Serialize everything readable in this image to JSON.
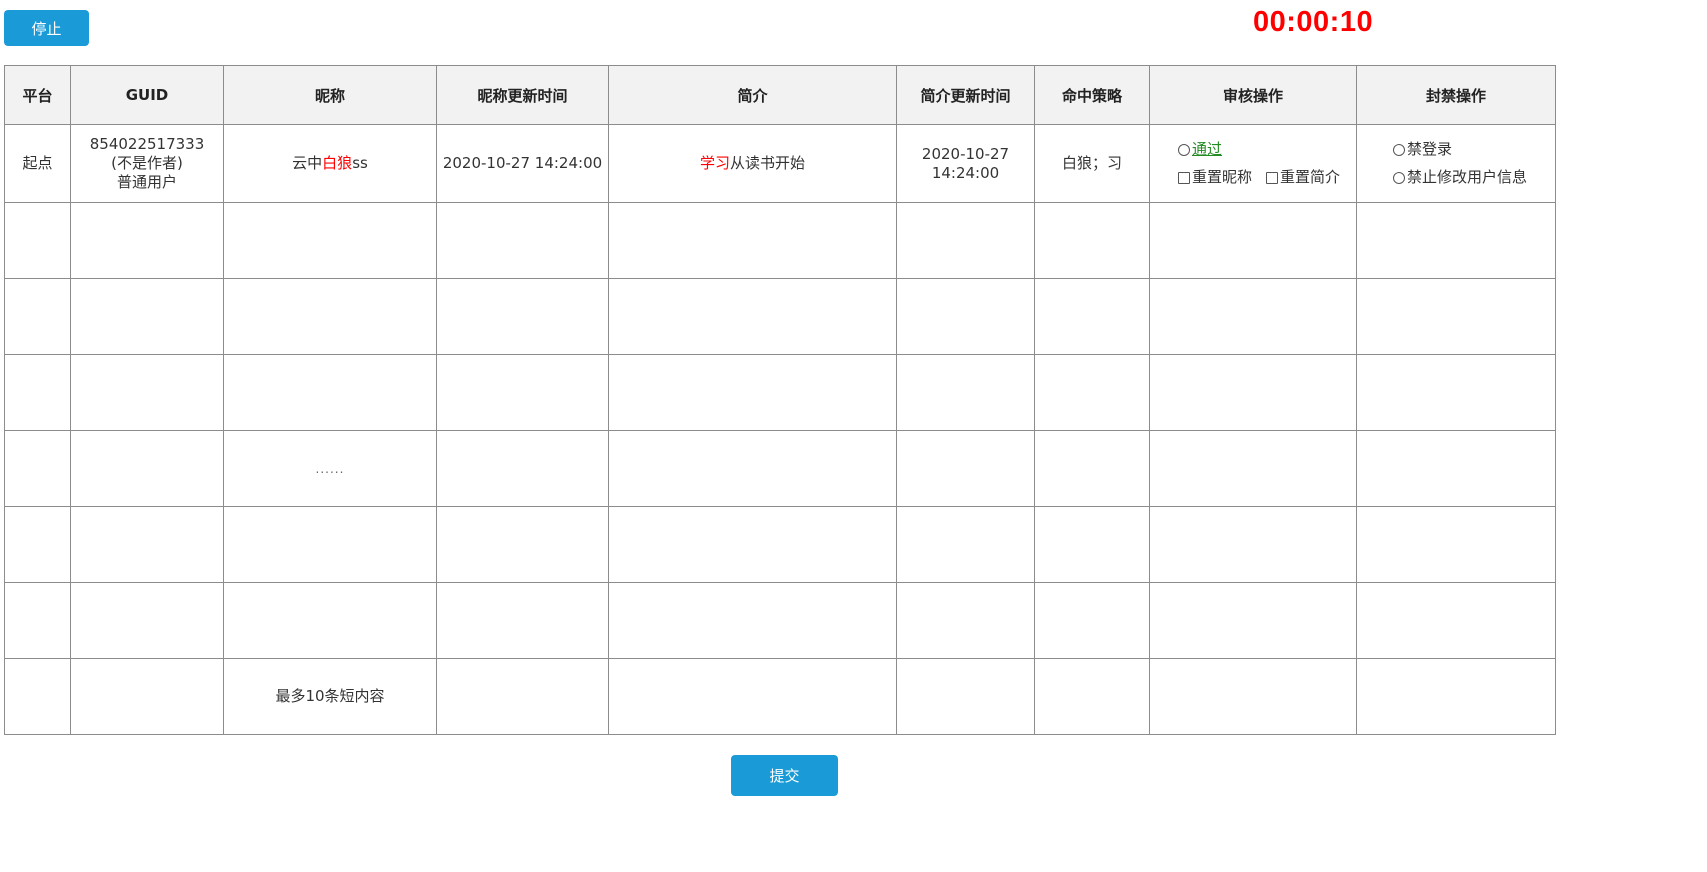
{
  "controls": {
    "stop_label": "停止",
    "submit_label": "提交",
    "timer": "00:00:10"
  },
  "table": {
    "headers": [
      "平台",
      "GUID",
      "昵称",
      "昵称更新时间",
      "简介",
      "简介更新时间",
      "命中策略",
      "审核操作",
      "封禁操作"
    ],
    "row": {
      "platform": "起点",
      "guid_id": "854022517333",
      "guid_author": "(不是作者)",
      "guid_user_type": "普通用户",
      "nickname_prefix": "云中",
      "nickname_highlight": "白狼",
      "nickname_suffix": "ss",
      "nickname_update_time": "2020-10-27 14:24:00",
      "intro_highlight": "学习",
      "intro_rest": "从读书开始",
      "intro_update_time_date": "2020-10-27",
      "intro_update_time_time": "14:24:00",
      "hit_strategy": "白狼；习",
      "review_pass_label": "通过",
      "review_reset_nickname_label": "重置昵称",
      "review_reset_intro_label": "重置简介",
      "ban_login_label": "禁登录",
      "ban_modify_info_label": "禁止修改用户信息"
    },
    "placeholder_ellipsis": "......",
    "max_note": "最多10条短内容"
  },
  "colors": {
    "button_bg": "#1a9bd7",
    "timer": "#ff0000",
    "highlight": "#ff0000",
    "pass_label": "#228b22",
    "header_bg": "#f2f2f2"
  }
}
